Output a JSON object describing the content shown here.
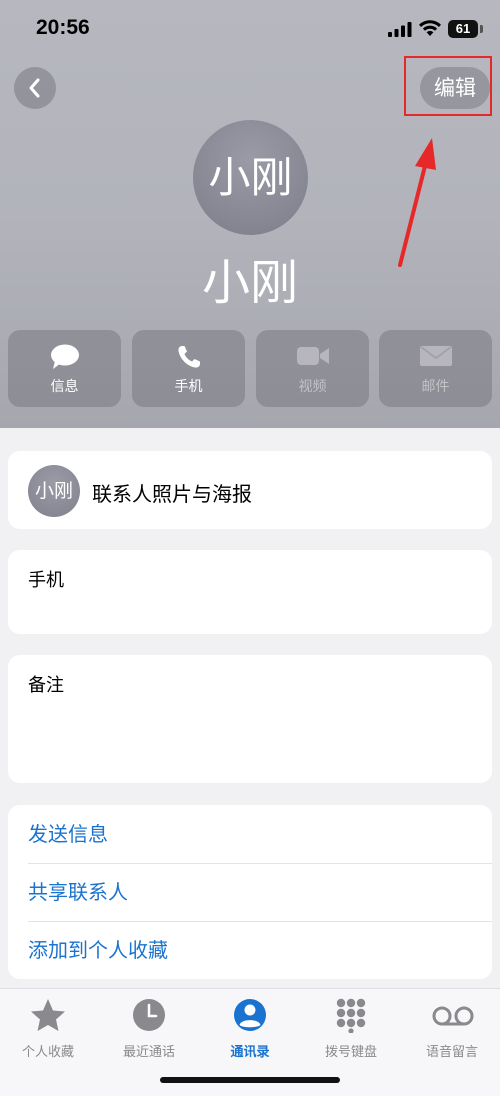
{
  "status_bar": {
    "time": "20:56",
    "battery": "61"
  },
  "header": {
    "edit_label": "编辑",
    "avatar_initials": "小刚",
    "contact_name": "小刚"
  },
  "actions": [
    {
      "label": "信息",
      "icon": "message-bubble-icon",
      "enabled": true
    },
    {
      "label": "手机",
      "icon": "phone-icon",
      "enabled": true
    },
    {
      "label": "视频",
      "icon": "video-camera-icon",
      "enabled": false
    },
    {
      "label": "邮件",
      "icon": "envelope-icon",
      "enabled": false
    }
  ],
  "poster_card": {
    "avatar_initials": "小刚",
    "label": "联系人照片与海报"
  },
  "phone_card": {
    "label": "手机"
  },
  "notes_card": {
    "label": "备注"
  },
  "links": [
    "发送信息",
    "共享联系人",
    "添加到个人收藏"
  ],
  "tabbar": {
    "items": [
      {
        "label": "个人收藏",
        "icon": "star-icon",
        "active": false
      },
      {
        "label": "最近通话",
        "icon": "clock-icon",
        "active": false
      },
      {
        "label": "通讯录",
        "icon": "person-circle-icon",
        "active": true
      },
      {
        "label": "拨号键盘",
        "icon": "keypad-icon",
        "active": false
      },
      {
        "label": "语音留言",
        "icon": "voicemail-icon",
        "active": false
      }
    ]
  },
  "colors": {
    "accent": "#1a73cf",
    "highlight_box": "#e62828",
    "inactive_tab": "#8a8a8e"
  }
}
